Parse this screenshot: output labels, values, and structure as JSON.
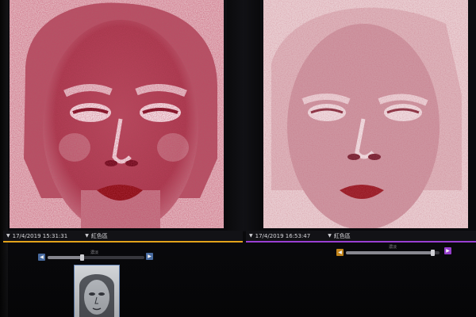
{
  "viewer": {
    "left_panel": {
      "timestamp": "17/4/2019 15:31:31",
      "mode": "紅色區",
      "control_label": "濃淡",
      "accent": "#e2a21a",
      "button_color": "#4b6fa6",
      "slider_level": 0.35
    },
    "right_panel": {
      "timestamp": "17/4/2019 16:53:47",
      "mode": "紅色區",
      "control_label": "濃淡",
      "accent": "#9a3fd2",
      "button_color": "#c8881c",
      "slider_level": 0.92
    }
  },
  "icons": {
    "dropdown": "triangle-down-icon",
    "face_thumbnail": "face-thumbnail"
  }
}
